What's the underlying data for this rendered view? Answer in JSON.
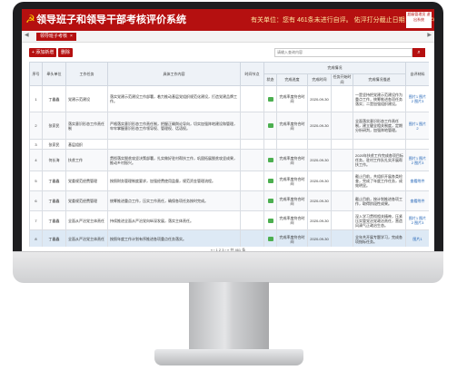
{
  "header": {
    "title": "领导班子和领导干部考核评价系统",
    "marquee": "有关单位：您有 461条未进行自评。  佑泙打分截止日期：  2021年03月",
    "user_box": "超级管理员 退出系统"
  },
  "tabs": {
    "active_label": "领导班子考核"
  },
  "toolbar": {
    "add_label": "+ 添加新增",
    "delete_label": "删除",
    "search_placeholder": "请输入查询内容",
    "search_icon": "search-icon"
  },
  "table": {
    "group_header": "完成情况",
    "columns": [
      "序号",
      "牵头单位",
      "工作任务",
      "具体工作内容",
      "时间节点",
      "状态",
      "完成进度",
      "完成时间",
      "任务开始时间",
      "完成情况描述",
      "自评材料"
    ],
    "rows": [
      {
        "no": "1",
        "unit": "丁鑫鑫",
        "task": "党建示范建设",
        "content": "落实党建示范建设工作部署，着力推动基层党组织规范化建设，打造党建品牌工作。",
        "node": "",
        "progress": "完成率度符合时间",
        "done_time": "2020-09-30",
        "start": "",
        "desc": "一是坚持把党建示范建设作为重点工作，统筹推进各项任务落实；二是加强组织建设。",
        "material": "图片1 图片2 图片3"
      },
      {
        "no": "2",
        "unit": "张家民",
        "task": "落实意识形态工作责任制",
        "content": "严格落实意识形态工作责任制，把握正确舆论导向，切实加强阵地建设和管理，牢牢掌握意识形态工作领导权、管理权、话语权。",
        "node": "",
        "progress": "完成率度符合时间",
        "done_time": "2020-09-30",
        "start": "",
        "desc": "全面落实意识形态工作责任制，建立健全相关制度，定期分析研判，加强阵地管理。",
        "material": "图片1 图片2"
      },
      {
        "no": "3",
        "unit": "张家民",
        "task": "基层组织",
        "content": "",
        "node": "",
        "progress": "",
        "done_time": "",
        "start": "",
        "desc": "",
        "material": ""
      },
      {
        "no": "4",
        "unit": "何长海",
        "task": "扶贫工作",
        "content": "贯彻落实脱贫攻坚决策部署，扎实做好驻村帮扶工作，巩固拓展脱贫攻坚成果，推动乡村振兴。",
        "node": "",
        "progress": "完成率度符合时间",
        "done_time": "2020-09-30",
        "start": "",
        "desc": "2020年扶贫工作完成各项目标任务，驻村工作队扎实开展帮扶工作。",
        "material": "图片1 图片2 图片3"
      },
      {
        "no": "5",
        "unit": "丁鑫鑫",
        "task": "党委规范经费管理",
        "content": "按照财务管理制度要求，加强经费使用监督，规范资金管理流程。",
        "node": "",
        "progress": "完成率度符合时间",
        "done_time": "2020-09-30",
        "start": "",
        "desc": "截止目前，共组织开展各类检查，完成了年度工作任务，成效明显。",
        "material": "查看附件"
      },
      {
        "no": "6",
        "unit": "丁鑫鑫",
        "task": "党委规范经费管理",
        "content": "统筹推进重点工作，压实工作责任，确保各项任务按时完成。",
        "node": "",
        "progress": "完成率度符合时间",
        "done_time": "2020-09-30",
        "start": "",
        "desc": "截止目前，按计划推进各项工作，取得阶段性成果。",
        "material": "查看附件"
      },
      {
        "no": "7",
        "unit": "丁鑫鑫",
        "task": "全面从严治党主体责任",
        "content": "持续推进全面从严治党向纵深发展，落实主体责任。",
        "node": "",
        "progress": "完成率度符合时间",
        "done_time": "2020-09-30",
        "start": "",
        "desc": "深入学习贯彻相关精神，压紧压实管党治党政治责任，营造风清气正政治生态。",
        "material": "图片1 图片2 图片3"
      },
      {
        "no": "8",
        "unit": "丁鑫鑫",
        "task": "全面从严治党主体责任",
        "content": "按照年度工作计划有序推进各项重点任务落实。",
        "node": "",
        "progress": "完成率度符合时间",
        "done_time": "2020-09-30",
        "start": "",
        "desc": "全年共开展专题学习，完成各项指标任务。",
        "material": "图片1"
      }
    ]
  },
  "pager": {
    "text": "« ‹  1  2  3  › »  共 461 条"
  }
}
